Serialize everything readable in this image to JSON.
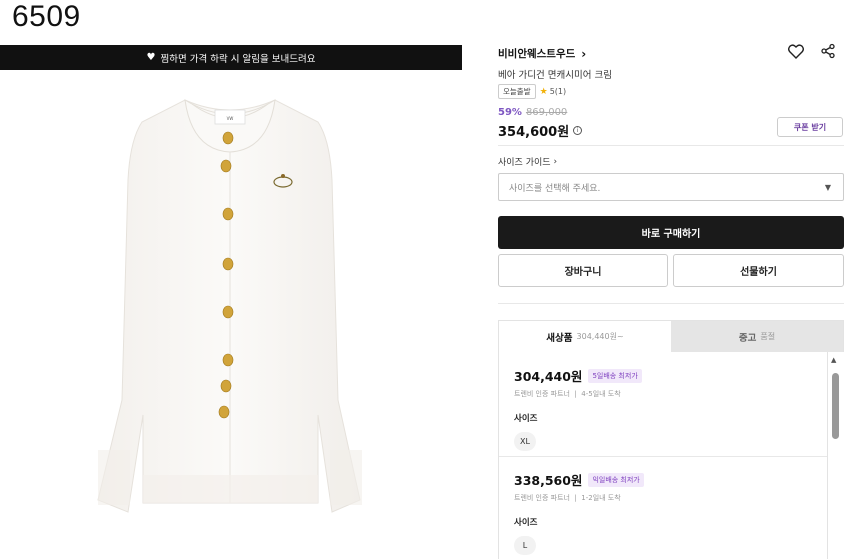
{
  "page_id": "6509",
  "banner": {
    "text": "찜하면 가격 하락 시 알림을 보내드려요"
  },
  "brand": {
    "name": "비비안웨스트우드",
    "chevron": "›"
  },
  "product": {
    "name": "베아 가디건 면캐시미어 크림",
    "tag": "오늘출발",
    "rating": "5(1)",
    "discount": "59%",
    "original_price": "869,000",
    "price": "354,600원",
    "coupon_label": "쿠폰 받기"
  },
  "icons": {
    "wishlist": "heart-icon",
    "share": "share-icon",
    "price_info": "info-icon"
  },
  "size_guide": {
    "label": "사이즈 가이드"
  },
  "size_select": {
    "placeholder": "사이즈를 선택해 주세요."
  },
  "actions": {
    "buy": "바로 구매하기",
    "cart": "장바구니",
    "gift": "선물하기"
  },
  "tabs": [
    {
      "label": "새상품",
      "sub": "304,440원~"
    },
    {
      "label": "중고",
      "sub": "품절"
    }
  ],
  "offers": [
    {
      "price": "304,440원",
      "badge": "5일배송 최저가",
      "seller": "트렌비 인증 파트너",
      "delivery": "4-5일내 도착",
      "size_label": "사이즈",
      "size": "XL"
    },
    {
      "price": "338,560원",
      "badge": "익일배송 최저가",
      "seller": "트렌비 인증 파트너",
      "delivery": "1-2일내 도착",
      "size_label": "사이즈",
      "size": "L"
    }
  ],
  "colors": {
    "accent": "#7e57c2",
    "buy_button": "#1a1a1a",
    "banner": "#111111"
  }
}
